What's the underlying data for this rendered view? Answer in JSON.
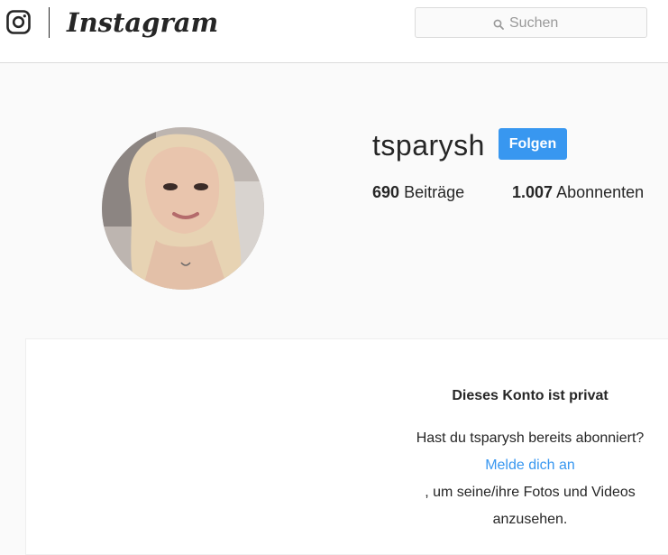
{
  "header": {
    "brand": "Instagram",
    "search_placeholder": "Suchen",
    "icons": {
      "logo": "instagram-glyph-icon",
      "search": "search-icon"
    }
  },
  "profile": {
    "username": "tsparysh",
    "follow_label": "Folgen",
    "follow_color": "#3897f0",
    "stats": {
      "posts_count": "690",
      "posts_label": "Beiträge",
      "followers_count": "1.007",
      "followers_label": "Abonnenten"
    }
  },
  "private_notice": {
    "title": "Dieses Konto ist privat",
    "line1": "Hast du tsparysh bereits abonniert?",
    "login_link": "Melde dich an",
    "line2": ", um seine/ihre Fotos und Videos",
    "line3": "anzusehen."
  }
}
